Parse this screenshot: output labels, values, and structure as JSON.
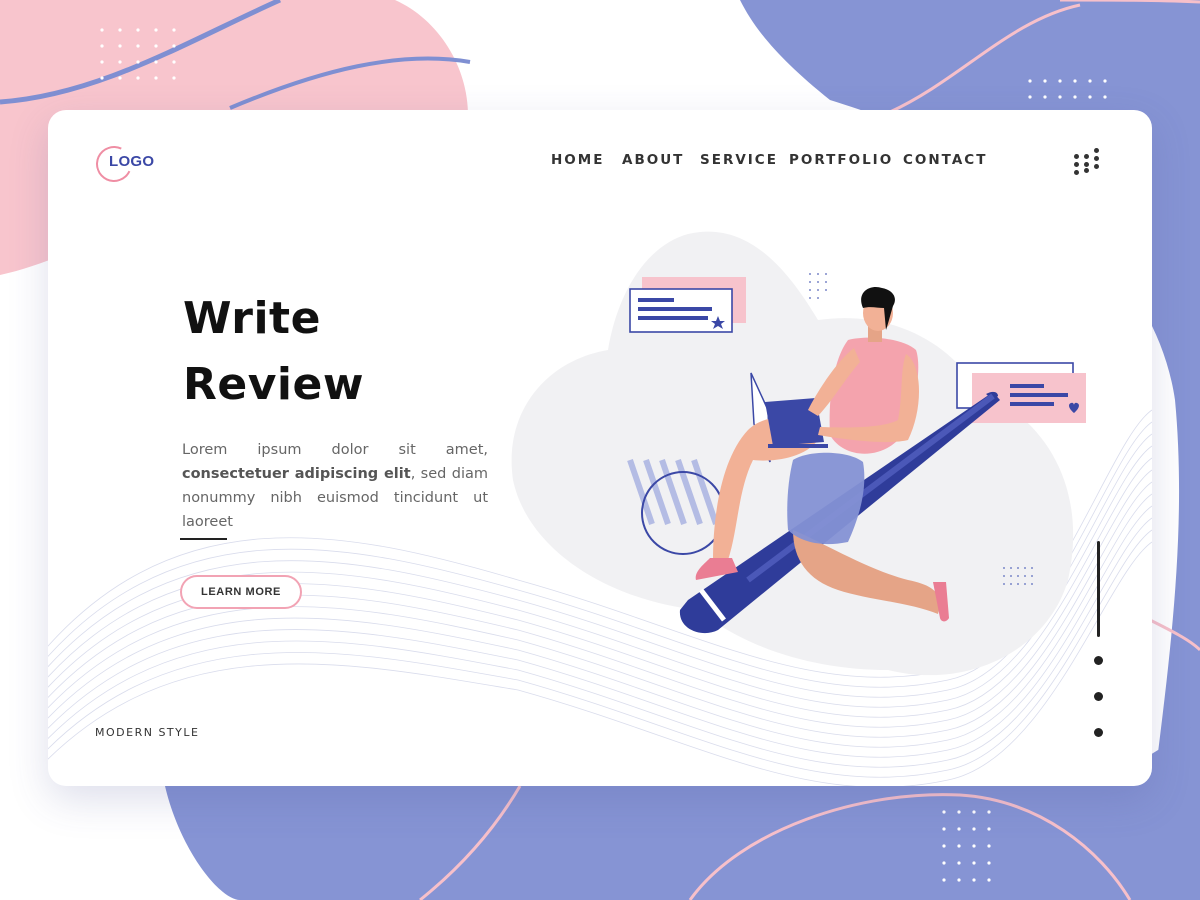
{
  "logo": {
    "text": "LOGO"
  },
  "nav": {
    "items": [
      {
        "label": "HOME"
      },
      {
        "label": "ABOUT"
      },
      {
        "label": "SERVICE"
      },
      {
        "label": "PORTFOLIO"
      },
      {
        "label": "CONTACT"
      }
    ]
  },
  "hero": {
    "title": "Write\nReview",
    "body_plain_1": "Lorem ipsum dolor sit amet, ",
    "body_bold": "consectetuer adipiscing elit",
    "body_plain_2": ", sed diam nonummy nibh euismod tincidunt ut laoreet",
    "button_label": "LEARN MORE"
  },
  "footer": {
    "tagline": "MODERN STYLE"
  },
  "pager": {
    "current_slide": 1,
    "slide_count": 4
  },
  "colors": {
    "pink": "#f8c5cd",
    "periwinkle": "#8694d4",
    "navy": "#3b48a6",
    "accent_pink": "#ef8ea4",
    "skin": "#f2b196"
  },
  "icons": {
    "menu": "grid-dots-icon",
    "review_card_left": "review-star-card-icon",
    "review_card_right": "review-heart-card-icon"
  }
}
